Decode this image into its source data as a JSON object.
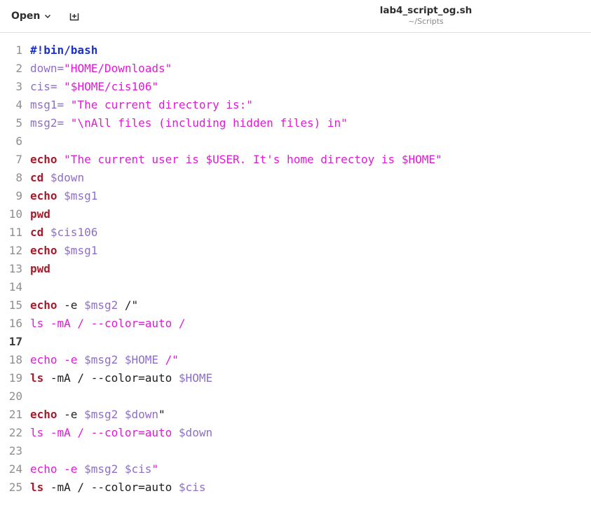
{
  "header": {
    "open_label": "Open",
    "title": "lab4_script_og.sh",
    "subtitle": "~/Scripts"
  },
  "icons": {
    "open": "chevron-down-icon",
    "new_tab": "new-tab-icon"
  },
  "colors": {
    "keyword": "#a51d2d",
    "shebang": "#1a32c9",
    "variable": "#8e6fc8",
    "string": "#e01bd5",
    "plain": "#1e1e1e"
  },
  "editor": {
    "current_line": 17,
    "lines": [
      {
        "num": "1",
        "tokens": [
          {
            "t": "#!bin/bash",
            "c": "shebang"
          }
        ]
      },
      {
        "num": "2",
        "tokens": [
          {
            "t": "down=",
            "c": "var"
          },
          {
            "t": "\"HOME/Downloads\"",
            "c": "str"
          }
        ]
      },
      {
        "num": "3",
        "tokens": [
          {
            "t": "cis= ",
            "c": "var"
          },
          {
            "t": "\"$HOME/cis106\"",
            "c": "str"
          }
        ]
      },
      {
        "num": "4",
        "tokens": [
          {
            "t": "msg1= ",
            "c": "var"
          },
          {
            "t": "\"The current directory is:\"",
            "c": "str"
          }
        ]
      },
      {
        "num": "5",
        "tokens": [
          {
            "t": "msg2= ",
            "c": "var"
          },
          {
            "t": "\"\\nAll files (including hidden files) in\"",
            "c": "str"
          }
        ]
      },
      {
        "num": "6",
        "tokens": []
      },
      {
        "num": "7",
        "tokens": [
          {
            "t": "echo",
            "c": "kw"
          },
          {
            "t": " ",
            "c": "plain"
          },
          {
            "t": "\"The current user is $USER. It's home directoy is $HOME\"",
            "c": "str"
          }
        ]
      },
      {
        "num": "8",
        "tokens": [
          {
            "t": "cd",
            "c": "kw"
          },
          {
            "t": " ",
            "c": "plain"
          },
          {
            "t": "$down",
            "c": "var"
          }
        ]
      },
      {
        "num": "9",
        "tokens": [
          {
            "t": "echo",
            "c": "kw"
          },
          {
            "t": " ",
            "c": "plain"
          },
          {
            "t": "$msg1",
            "c": "var"
          }
        ]
      },
      {
        "num": "10",
        "tokens": [
          {
            "t": "pwd",
            "c": "kw"
          }
        ]
      },
      {
        "num": "11",
        "tokens": [
          {
            "t": "cd",
            "c": "kw"
          },
          {
            "t": " ",
            "c": "plain"
          },
          {
            "t": "$cis106",
            "c": "var"
          }
        ]
      },
      {
        "num": "12",
        "tokens": [
          {
            "t": "echo",
            "c": "kw"
          },
          {
            "t": " ",
            "c": "plain"
          },
          {
            "t": "$msg1",
            "c": "var"
          }
        ]
      },
      {
        "num": "13",
        "tokens": [
          {
            "t": "pwd",
            "c": "kw"
          }
        ]
      },
      {
        "num": "14",
        "tokens": []
      },
      {
        "num": "15",
        "tokens": [
          {
            "t": "echo",
            "c": "kw"
          },
          {
            "t": " -e ",
            "c": "plain"
          },
          {
            "t": "$msg2",
            "c": "var"
          },
          {
            "t": " /\"",
            "c": "plain"
          }
        ]
      },
      {
        "num": "16",
        "tokens": [
          {
            "t": "ls -mA / --color=auto /",
            "c": "str"
          }
        ]
      },
      {
        "num": "17",
        "tokens": []
      },
      {
        "num": "18",
        "tokens": [
          {
            "t": "echo -e ",
            "c": "str"
          },
          {
            "t": "$msg2 $HOME",
            "c": "var"
          },
          {
            "t": " /\"",
            "c": "str"
          }
        ]
      },
      {
        "num": "19",
        "tokens": [
          {
            "t": "ls",
            "c": "kw"
          },
          {
            "t": " -mA / --color=auto ",
            "c": "plain"
          },
          {
            "t": "$HOME",
            "c": "var"
          }
        ]
      },
      {
        "num": "20",
        "tokens": []
      },
      {
        "num": "21",
        "tokens": [
          {
            "t": "echo",
            "c": "kw"
          },
          {
            "t": " -e ",
            "c": "plain"
          },
          {
            "t": "$msg2 $down",
            "c": "var"
          },
          {
            "t": "\"",
            "c": "plain"
          }
        ]
      },
      {
        "num": "22",
        "tokens": [
          {
            "t": "ls -mA / --color=auto ",
            "c": "str"
          },
          {
            "t": "$down",
            "c": "var"
          }
        ]
      },
      {
        "num": "23",
        "tokens": []
      },
      {
        "num": "24",
        "tokens": [
          {
            "t": "echo -e ",
            "c": "str"
          },
          {
            "t": "$msg2 $cis",
            "c": "var"
          },
          {
            "t": "\"",
            "c": "str"
          }
        ]
      },
      {
        "num": "25",
        "tokens": [
          {
            "t": "ls",
            "c": "kw"
          },
          {
            "t": " -mA / --color=auto ",
            "c": "plain"
          },
          {
            "t": "$cis",
            "c": "var"
          }
        ]
      }
    ]
  }
}
